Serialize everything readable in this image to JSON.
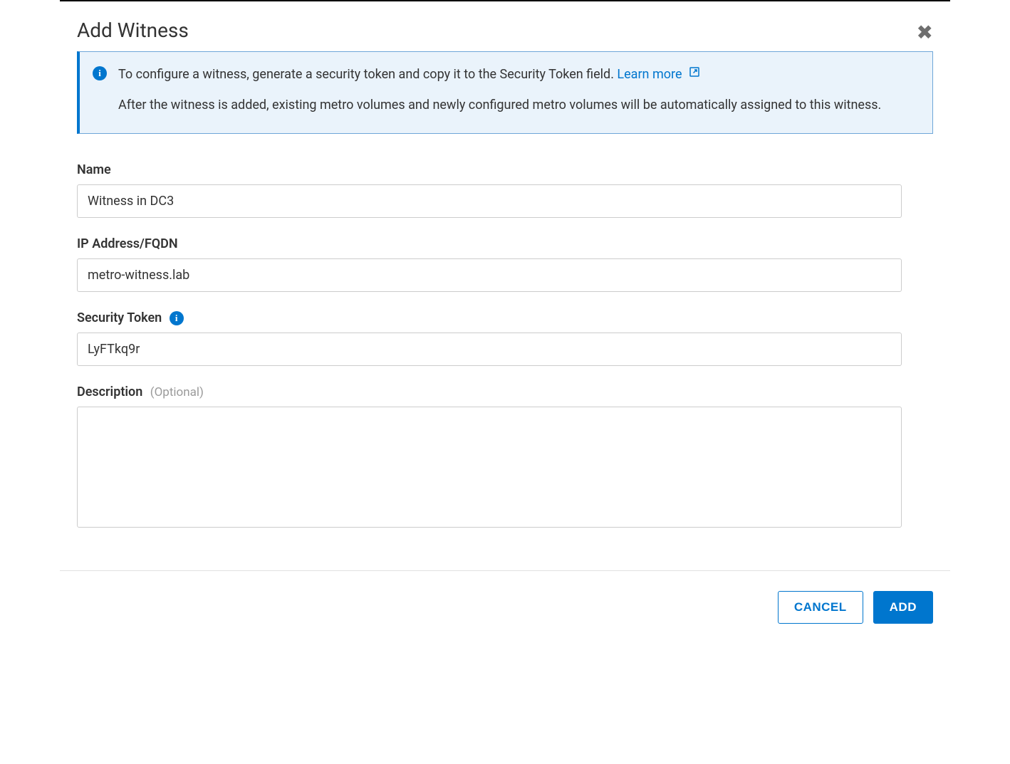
{
  "dialog": {
    "title": "Add Witness"
  },
  "info": {
    "line1_prefix": "To configure a witness, generate a security token and copy it to the Security Token field. ",
    "learn_more": "Learn more",
    "line2": "After the witness is added, existing metro volumes and newly configured metro volumes will be automatically assigned to this witness."
  },
  "form": {
    "name": {
      "label": "Name",
      "value": "Witness in DC3"
    },
    "ip": {
      "label": "IP Address/FQDN",
      "value": "metro-witness.lab"
    },
    "token": {
      "label": "Security Token",
      "value": "LyFTkq9r"
    },
    "description": {
      "label": "Description",
      "optional": "(Optional)",
      "value": ""
    }
  },
  "buttons": {
    "cancel": "CANCEL",
    "add": "ADD"
  }
}
